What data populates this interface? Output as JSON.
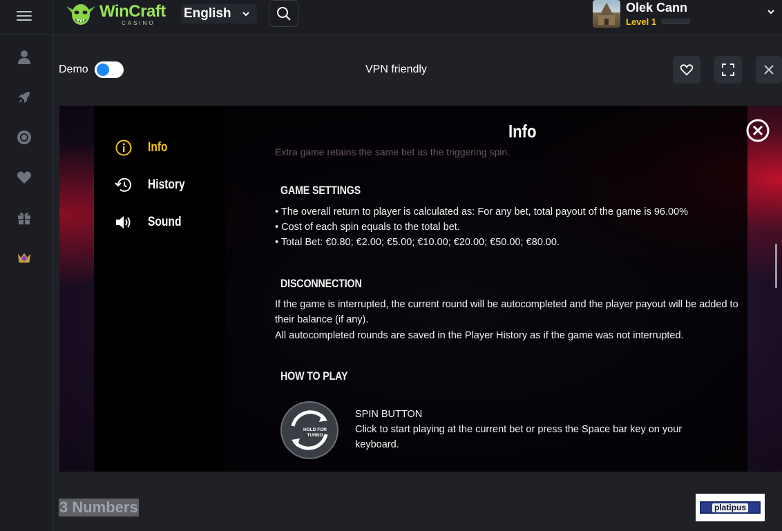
{
  "header": {
    "brand_name": "WinCraft",
    "brand_sub": "CASINO",
    "language": "English",
    "user": {
      "name": "Olek Cann",
      "level": "Level 1"
    },
    "icons": {
      "menu": "hamburger-icon",
      "search": "search-icon",
      "user_menu": "chevron-down-icon"
    }
  },
  "sidebar": {
    "items": [
      {
        "icon": "user-icon"
      },
      {
        "icon": "rocket-icon"
      },
      {
        "icon": "poker-chip-icon"
      },
      {
        "icon": "heart-icon"
      },
      {
        "icon": "gift-icon"
      },
      {
        "icon": "crown-icon"
      }
    ]
  },
  "game_header": {
    "demo_label": "Demo",
    "demo_enabled": true,
    "vpn_label": "VPN friendly",
    "buttons": [
      "heart-icon",
      "fullscreen-icon",
      "close-icon"
    ]
  },
  "info_panel": {
    "title": "Info",
    "menu": [
      {
        "label": "Info",
        "icon": "info-icon",
        "active": true
      },
      {
        "label": "History",
        "icon": "history-icon",
        "active": false
      },
      {
        "label": "Sound",
        "icon": "speaker-icon",
        "active": false
      }
    ],
    "faded_text": "Extra game retains the same bet as the triggering spin.",
    "sections": {
      "game_settings": {
        "title": "GAME SETTINGS",
        "lines": [
          "• The overall return to player is calculated as: For any bet, total payout of the game is 96.00%",
          "• Cost of each spin equals to the total bet.",
          "• Total Bet: €0.80; €2.00; €5.00; €10.00; €20.00; €50.00; €80.00."
        ]
      },
      "disconnection": {
        "title": "DISCONNECTION",
        "para1": "If the game is interrupted, the current round will be autocompleted and the player payout will be added to their balance (if any).",
        "para2": "All autocompleted rounds are saved in the Player History as if the game was not interrupted."
      },
      "how_to_play": {
        "title": "HOW TO PLAY",
        "spin_icon_text": "HOLD FOR TURBO",
        "spin_title": "SPIN BUTTON",
        "spin_desc": "Click to start playing at the current bet or press the Space bar key on your keyboard."
      }
    }
  },
  "footer": {
    "game_name": "3 Numbers",
    "provider": "platipus"
  },
  "colors": {
    "accent_yellow": "#f5c518",
    "toggle_blue": "#1e88f5",
    "brand_green": "#9be35a",
    "background": "#1f2126"
  }
}
